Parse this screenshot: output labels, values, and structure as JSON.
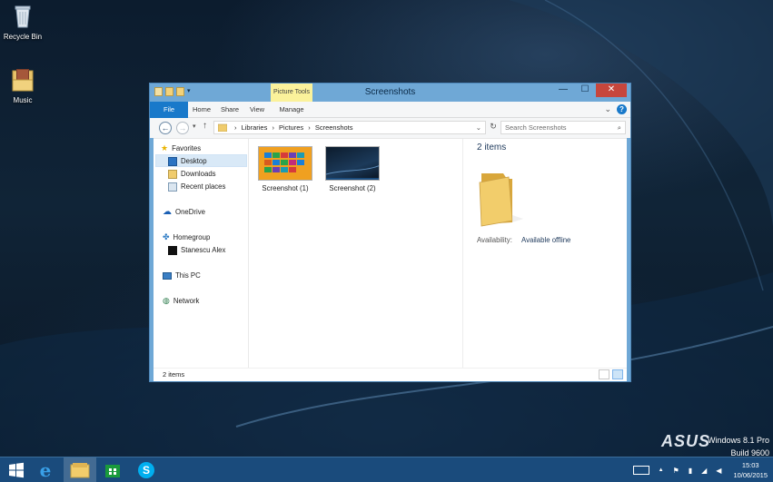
{
  "desktop": {
    "icons": [
      {
        "label": "Recycle Bin",
        "icon": "recycle-bin-icon"
      },
      {
        "label": "Music",
        "icon": "music-folder-icon"
      }
    ],
    "brand": "ASUS",
    "os_name": "Windows 8.1 Pro",
    "build": "Build 9600"
  },
  "window": {
    "title": "Screenshots",
    "contextual_tab": "Picture Tools",
    "controls": {
      "minimize": "—",
      "maximize": "☐",
      "close": "✕"
    },
    "ribbon_tabs": [
      "File",
      "Home",
      "Share",
      "View",
      "Manage"
    ],
    "address": {
      "crumbs": [
        "Libraries",
        "Pictures",
        "Screenshots"
      ],
      "separator": "›"
    },
    "search": {
      "placeholder": "Search Screenshots"
    },
    "nav": {
      "favorites": "Favorites",
      "desktop": "Desktop",
      "downloads": "Downloads",
      "recent": "Recent places",
      "onedrive": "OneDrive",
      "homegroup": "Homegroup",
      "user": "Stanescu Alex",
      "thispc": "This PC",
      "network": "Network"
    },
    "files": [
      {
        "name": "Screenshot (1)"
      },
      {
        "name": "Screenshot (2)"
      }
    ],
    "details": {
      "count": "2 items",
      "availability_label": "Availability:",
      "availability_value": "Available offline"
    },
    "status": "2 items"
  },
  "taskbar": {
    "clock_time": "15:03",
    "clock_date": "10/06/2015",
    "tray_arrow": "▲"
  },
  "colors": {
    "accent": "#1979ca",
    "titlebar": "#6fa8d6",
    "close": "#c7463c",
    "taskbar": "#1a4b7c",
    "picture_tools": "#fbf29b"
  }
}
